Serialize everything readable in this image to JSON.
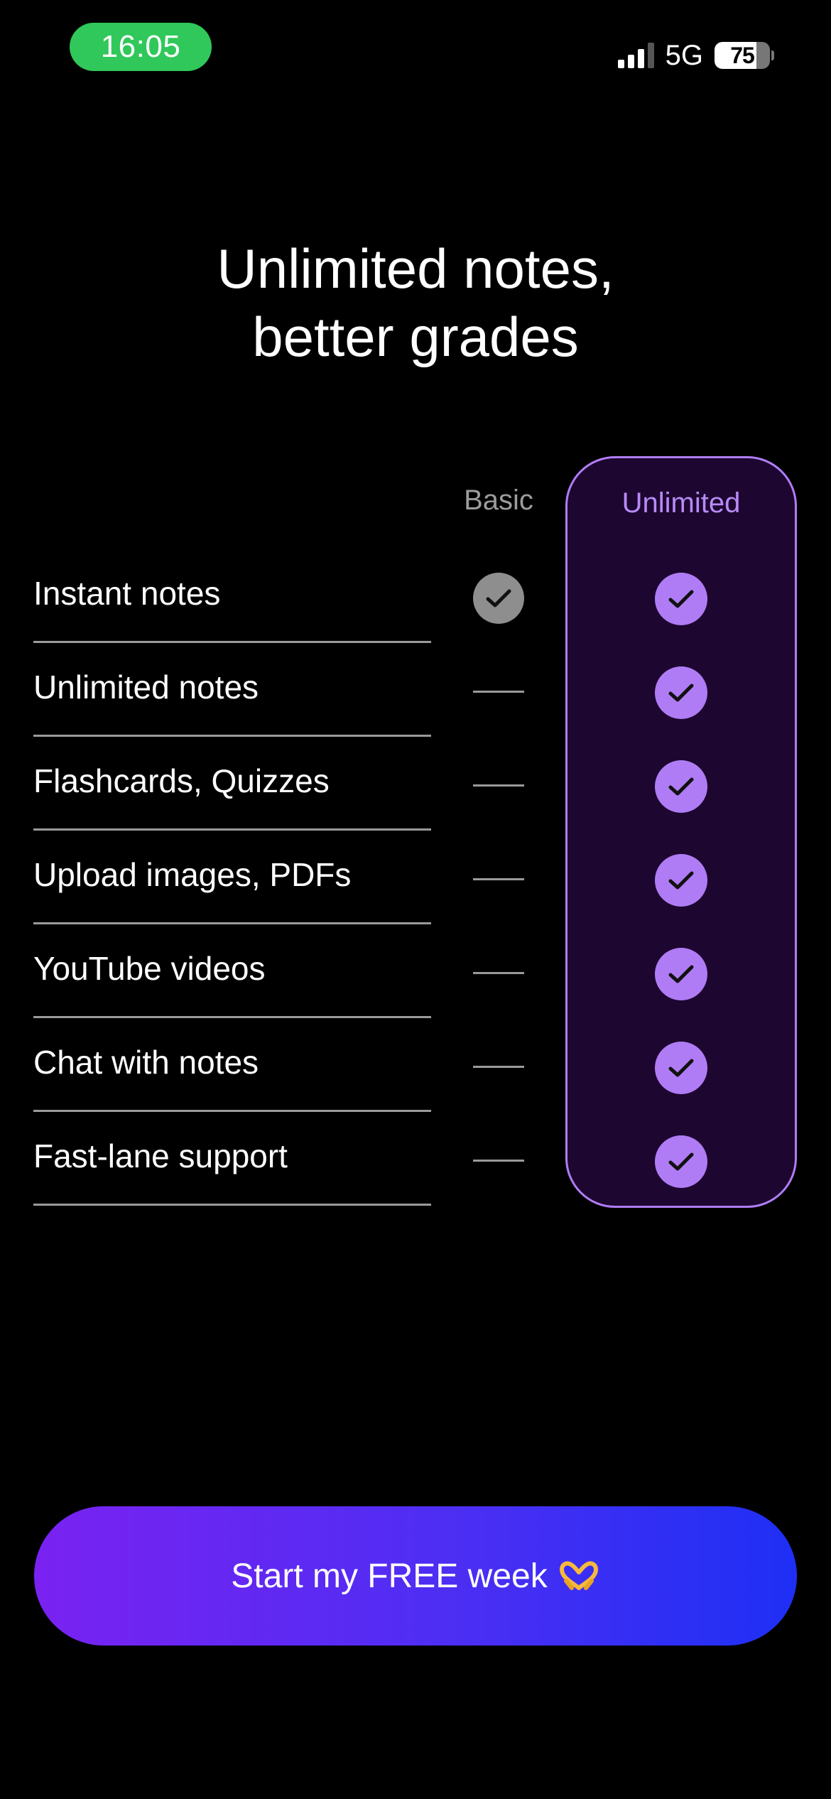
{
  "status_bar": {
    "time": "16:05",
    "network": "5G",
    "battery": "75",
    "battery_level": 0.75,
    "time_pill_color": "#30c85a"
  },
  "headline": {
    "line1": "Unlimited notes,",
    "line2": "better grades"
  },
  "plans": {
    "basic_label": "Basic",
    "unlimited_label": "Unlimited",
    "accent_color": "#b07cf5"
  },
  "features": [
    {
      "label": "Instant notes",
      "basic": true,
      "unlimited": true
    },
    {
      "label": "Unlimited notes",
      "basic": false,
      "unlimited": true
    },
    {
      "label": "Flashcards, Quizzes",
      "basic": false,
      "unlimited": true
    },
    {
      "label": "Upload images, PDFs",
      "basic": false,
      "unlimited": true
    },
    {
      "label": "YouTube videos",
      "basic": false,
      "unlimited": true
    },
    {
      "label": "Chat with notes",
      "basic": false,
      "unlimited": true
    },
    {
      "label": "Fast-lane support",
      "basic": false,
      "unlimited": true
    }
  ],
  "cta": {
    "label": "Start my FREE week",
    "icon": "heart-hands-icon"
  }
}
